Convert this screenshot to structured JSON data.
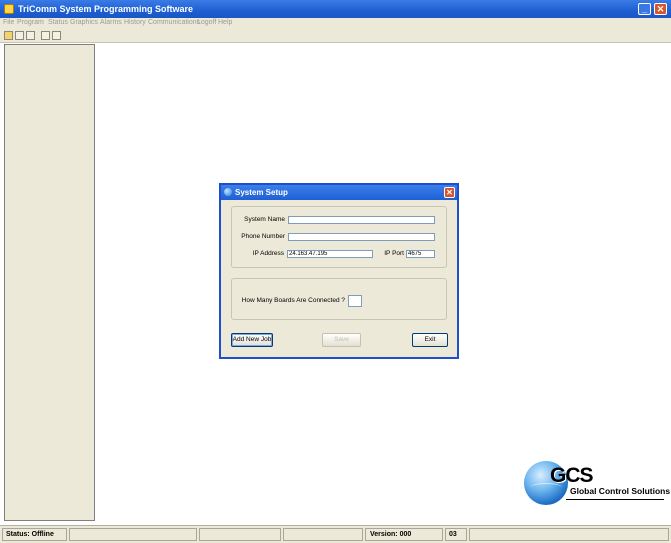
{
  "window": {
    "title": "TriComm System Programming Software"
  },
  "menu": [
    "File",
    "Program",
    "Status",
    "Graphics",
    "Alarms",
    "History",
    "Communications",
    "Logoff",
    "Help"
  ],
  "toolbar": [
    "open-icon",
    "save-icon",
    "print-icon",
    "view-icon",
    "settings-icon"
  ],
  "dialog": {
    "title": "System Setup",
    "fields": {
      "system_name": {
        "label": "System Name",
        "value": ""
      },
      "phone_number": {
        "label": "Phone Number",
        "value": ""
      },
      "ip_address": {
        "label": "IP Address",
        "value": "24.163.47.195"
      },
      "ip_port": {
        "label": "IP Port",
        "value": "4675"
      },
      "boards": {
        "label": "How Many Boards Are Connected ?",
        "value": ""
      }
    },
    "buttons": {
      "add_new_job": "Add New Job",
      "save": "Save",
      "exit": "Exit"
    }
  },
  "status": {
    "status_text": "Status: Offline",
    "version": "Version: 000",
    "code": "03"
  },
  "logo": {
    "big": "GCS",
    "sub": "Global Control Solutions"
  },
  "colors": {
    "titlebar": "#1d5fd2",
    "dialog_bg": "#ece9d8",
    "close_red": "#d9532c"
  }
}
